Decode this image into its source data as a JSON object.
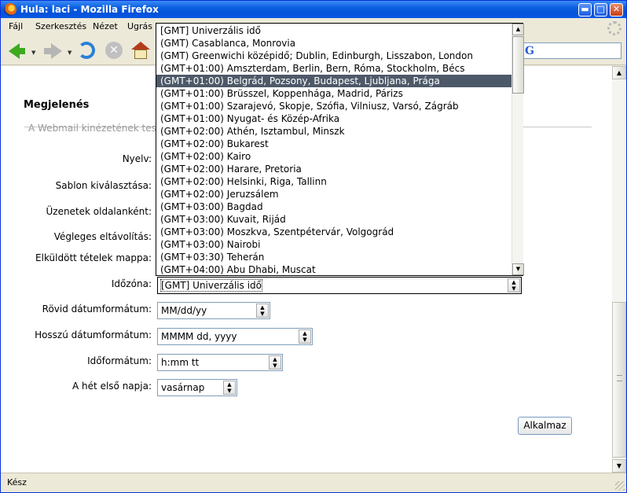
{
  "window": {
    "title": "Hula: laci - Mozilla Firefox"
  },
  "titlebar_buttons": {
    "minimize": "▬",
    "maximize": "□",
    "close": "✕"
  },
  "menu": [
    {
      "label": "Fájl"
    },
    {
      "label": "Szerkesztés"
    },
    {
      "label": "Nézet"
    },
    {
      "label": "Ugrás"
    }
  ],
  "icons": {
    "back": "back-arrow-icon",
    "forward": "forward-arrow-icon",
    "reload": "reload-icon",
    "stop": "stop-icon",
    "home": "home-icon",
    "search_engine": "google-icon",
    "throbber": "throbber-icon"
  },
  "search": {
    "engine_letter": "G"
  },
  "page": {
    "section_title": "Megjelenés",
    "section_desc": "A Webmail kinézetének test",
    "labels": {
      "language": "Nyelv:",
      "template": "Sablon kiválasztása:",
      "messages_per_page": "Üzenetek oldalanként:",
      "permanent_delete": "Végleges eltávolítás:",
      "sent_items": "Elküldött tételek mappa:",
      "timezone": "Időzóna:",
      "short_date": "Rövid dátumformátum:",
      "long_date": "Hosszú dátumformátum:",
      "time_format": "Időformátum:",
      "first_day": "A hét első napja:"
    },
    "values": {
      "timezone": "[GMT] Univerzális idő",
      "short_date": "MM/dd/yy",
      "long_date": "MMMM dd, yyyy",
      "time_format": "h:mm tt",
      "first_day": "vasárnap"
    },
    "apply_label": "Alkalmaz"
  },
  "timezone_list": {
    "selected_index": 4,
    "options": [
      "[GMT] Univerzális idő",
      "(GMT) Casablanca, Monrovia",
      "(GMT) Greenwichi középidő; Dublin, Edinburgh, Lisszabon, London",
      "(GMT+01:00) Amszterdam, Berlin, Bern, Róma, Stockholm, Bécs",
      "(GMT+01:00) Belgrád, Pozsony, Budapest, Ljubljana, Prága",
      "(GMT+01:00) Brüsszel, Koppenhága, Madrid, Párizs",
      "(GMT+01:00) Szarajevó, Skopje, Szófia, Vilniusz, Varsó, Zágráb",
      "(GMT+01:00) Nyugat- és Közép-Afrika",
      "(GMT+02:00) Athén, Isztambul, Minszk",
      "(GMT+02:00) Bukarest",
      "(GMT+02:00) Kairo",
      "(GMT+02:00) Harare, Pretoria",
      "(GMT+02:00) Helsinki, Riga, Tallinn",
      "(GMT+02:00) Jeruzsálem",
      "(GMT+03:00) Bagdad",
      "(GMT+03:00) Kuvait, Rijád",
      "(GMT+03:00) Moszkva, Szentpétervár, Volgográd",
      "(GMT+03:00) Nairobi",
      "(GMT+03:30) Teherán",
      "(GMT+04:00) Abu Dhabi, Muscat"
    ]
  },
  "status": {
    "text": "Kész"
  },
  "colors": {
    "selection": "#4d5968",
    "titlebar": "#0a5fe0"
  }
}
